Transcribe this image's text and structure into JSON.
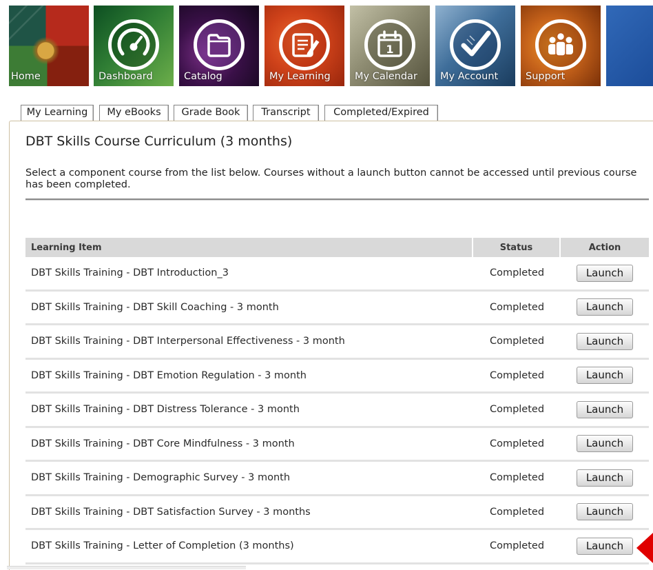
{
  "nav": {
    "tiles": [
      {
        "label": "Home",
        "icon": "home-collage-image"
      },
      {
        "label": "Dashboard",
        "icon": "speedometer-icon"
      },
      {
        "label": "Catalog",
        "icon": "folder-icon"
      },
      {
        "label": "My Learning",
        "icon": "notebook-pencil-icon"
      },
      {
        "label": "My Calendar",
        "icon": "calendar-icon",
        "icon_text": "1"
      },
      {
        "label": "My Account",
        "icon": "checkmark-icon"
      },
      {
        "label": "Support",
        "icon": "people-icon"
      }
    ]
  },
  "tabs": [
    {
      "label": "My Learning"
    },
    {
      "label": "My eBooks"
    },
    {
      "label": "Grade Book"
    },
    {
      "label": "Transcript"
    },
    {
      "label": "Completed/Expired"
    }
  ],
  "page": {
    "title": "DBT Skills Course Curriculum (3 months)",
    "instructions": {
      "line1": "Select a component course from the list below. Courses without a launch button cannot be accessed until previous course",
      "line2": "has been completed."
    }
  },
  "table": {
    "columns": {
      "item": "Learning Item",
      "status": "Status",
      "action": "Action"
    },
    "rows": [
      {
        "item": "DBT Skills Training - DBT Introduction_3",
        "status": "Completed",
        "action": "Launch"
      },
      {
        "item": "DBT Skills Training - DBT Skill Coaching - 3 month",
        "status": "Completed",
        "action": "Launch"
      },
      {
        "item": "DBT Skills Training - DBT Interpersonal Effectiveness - 3 month",
        "status": "Completed",
        "action": "Launch"
      },
      {
        "item": "DBT Skills Training - DBT Emotion Regulation - 3 month",
        "status": "Completed",
        "action": "Launch"
      },
      {
        "item": "DBT Skills Training - DBT Distress Tolerance - 3 month",
        "status": "Completed",
        "action": "Launch"
      },
      {
        "item": "DBT Skills Training - DBT Core Mindfulness - 3 month",
        "status": "Completed",
        "action": "Launch"
      },
      {
        "item": "DBT Skills Training - Demographic Survey - 3 month",
        "status": "Completed",
        "action": "Launch"
      },
      {
        "item": "DBT Skills Training - DBT Satisfaction Survey - 3 months",
        "status": "Completed",
        "action": "Launch"
      },
      {
        "item": "DBT Skills Training - Letter of Completion (3 months)",
        "status": "Completed",
        "action": "Launch"
      }
    ]
  },
  "colors": {
    "header_row_bg": "#d9d9d9",
    "row_separator": "#e2e2e2",
    "panel_border": "#cdbfa2",
    "pointer_arrow": "#e00000"
  }
}
